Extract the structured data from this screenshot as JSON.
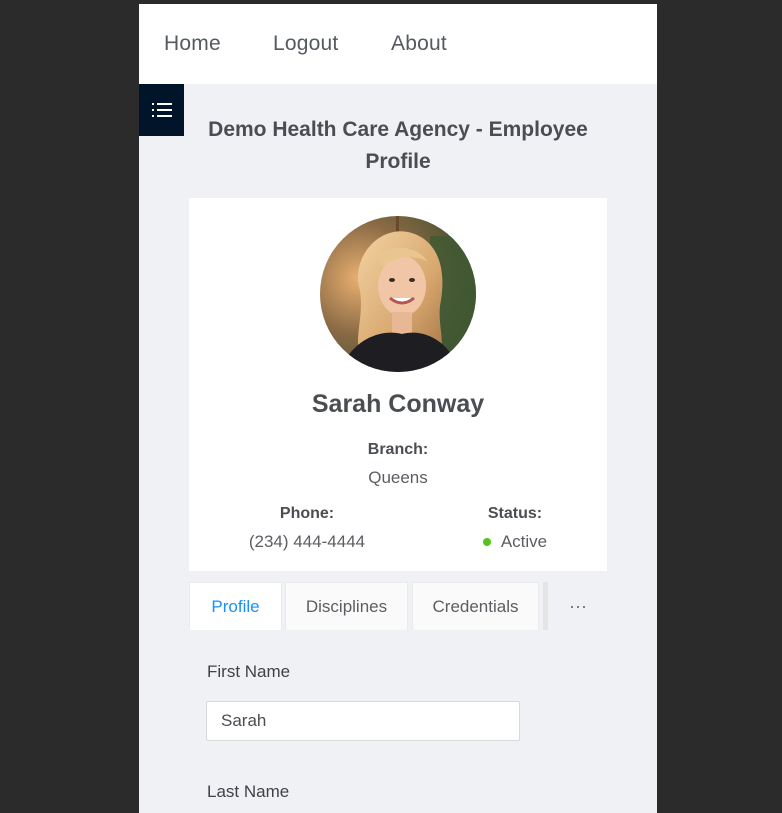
{
  "nav": {
    "items": [
      {
        "label": "Home"
      },
      {
        "label": "Logout"
      },
      {
        "label": "About"
      }
    ]
  },
  "sidebar_toggle": {
    "icon": "menu-list-icon"
  },
  "page": {
    "title": "Demo Health Care Agency - Employee Profile"
  },
  "profile": {
    "name": "Sarah Conway",
    "branch_label": "Branch:",
    "branch": "Queens",
    "phone_label": "Phone:",
    "phone": "(234) 444-4444",
    "status_label": "Status:",
    "status": "Active",
    "status_color": "#52c41a"
  },
  "tabs": {
    "items": [
      {
        "label": "Profile",
        "active": true
      },
      {
        "label": "Disciplines",
        "active": false
      },
      {
        "label": "Credentials",
        "active": false
      }
    ],
    "more": "···"
  },
  "form": {
    "first_name_label": "First Name",
    "first_name_value": "Sarah",
    "last_name_label": "Last Name"
  },
  "colors": {
    "accent": "#1890ff",
    "sidebar_toggle_bg": "#001529",
    "page_bg": "#f0f1f4"
  }
}
